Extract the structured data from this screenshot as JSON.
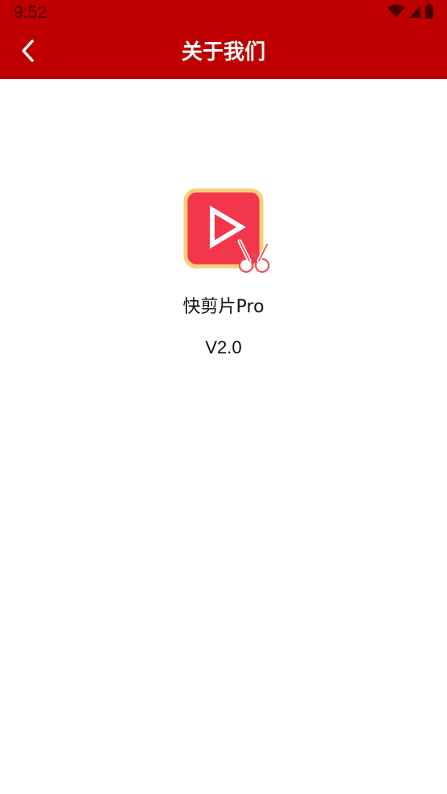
{
  "status_bar": {
    "time": "9:52",
    "icons": [
      "wifi-icon",
      "cellular-signal-icon",
      "battery-icon"
    ]
  },
  "toolbar": {
    "title": "关于我们",
    "back_icon": "chevron-left-icon"
  },
  "about": {
    "app_name": "快剪片Pro",
    "version": "V2.0",
    "logo_icon": "video-play-scissors-icon"
  },
  "colors": {
    "primary": "#be0000",
    "logo_red": "#f4364c",
    "logo_border": "#f9cf7a",
    "text": "#111111",
    "background": "#ffffff"
  }
}
